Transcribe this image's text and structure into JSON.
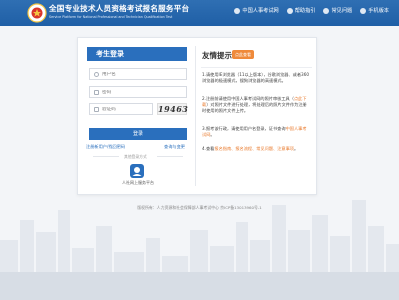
{
  "header": {
    "title": "全国专业技术人员资格考试报名服务平台",
    "subtitle": "Service Platform for National Professional and Technician Qualification Test",
    "links": [
      {
        "label": "中国人事考试网",
        "icon": "home-icon"
      },
      {
        "label": "帮助指引",
        "icon": "help-icon"
      },
      {
        "label": "常见问题",
        "icon": "question-icon"
      },
      {
        "label": "手机版本",
        "icon": "phone-icon"
      }
    ],
    "colors": {
      "bar": "#2368b0",
      "accent": "#2a6fbd",
      "highlight": "#e9792b"
    }
  },
  "login": {
    "header": "考生登录",
    "username_placeholder": "用户名",
    "password_placeholder": "密码",
    "captcha_placeholder": "验证码",
    "captcha_code": "19463",
    "button": "登录",
    "link_register": "注册新用户/找回密码",
    "link_forgot": "查询与变更",
    "separator": "其他登录方式",
    "face_label": "人社网上服务平台"
  },
  "tips": {
    "title": "友情提示",
    "badge": "点此查看",
    "items": [
      {
        "pre": "1.请使用IE浏览器（11以上版本），谷歌浏览器、或者360浏览器的极速模式，搜狗浏览器的高速模式。",
        "hl": "",
        "post": ""
      },
      {
        "pre": "2.注册前请使用中国人事考试网的照片审核工具（",
        "hl": "点此下载",
        "post": "）对照片文件进行处理，将处理后的照片文件作为注册时使用的照片文件上传。"
      },
      {
        "pre": "3.报考该行政，请使用用户名登录，证书查询",
        "hl": "中国人事考试网",
        "post": "。"
      },
      {
        "pre": "4.查看",
        "hl": "报名指南、报名流程、常见问题、注意事项",
        "post": "。"
      }
    ]
  },
  "footer": {
    "text": "版权所有：人力资源和社会保障部人事考试中心 京ICP备13013960号-1"
  }
}
